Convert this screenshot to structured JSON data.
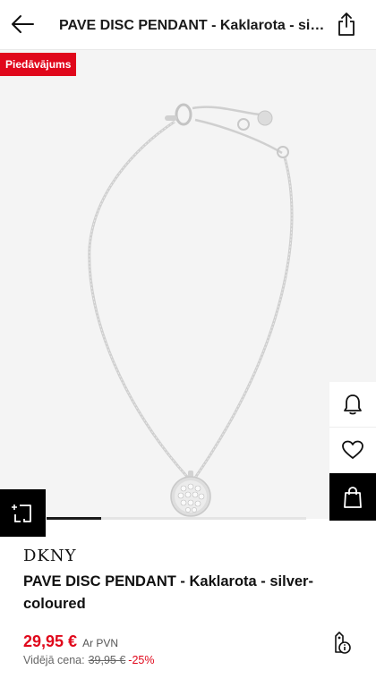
{
  "header": {
    "title": "PAVE DISC PENDANT - Kaklarota - silver-coloured",
    "back_icon": "arrow-left-icon",
    "share_icon": "share-icon"
  },
  "gallery": {
    "promo_badge": "Piedāvājums",
    "image_alt": "DKNY PAVE DISC PENDANT necklace",
    "current_image_progress": 0.21
  },
  "side_actions": {
    "notify_icon": "bell-icon",
    "wishlist_icon": "heart-icon",
    "cart_icon": "shopping-bag-icon"
  },
  "compare_icon": "compare-icon",
  "product": {
    "brand": "DKNY",
    "name": "PAVE DISC PENDANT - Kaklarota - silver-coloured",
    "price": "29,95 €",
    "vat_note": "Ar PVN",
    "old_price_label": "Vidējā cena:",
    "old_price": "39,95 €",
    "discount": "-25%"
  },
  "colors": {
    "accent": "#e0071b",
    "dark": "#000000"
  }
}
